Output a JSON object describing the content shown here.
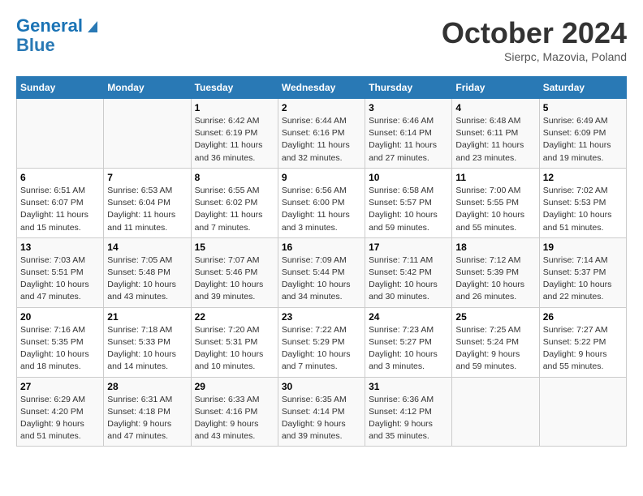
{
  "header": {
    "logo_line1": "General",
    "logo_line2": "Blue",
    "title": "October 2024",
    "subtitle": "Sierpc, Mazovia, Poland"
  },
  "weekdays": [
    "Sunday",
    "Monday",
    "Tuesday",
    "Wednesday",
    "Thursday",
    "Friday",
    "Saturday"
  ],
  "weeks": [
    [
      {
        "day": "",
        "sunrise": "",
        "sunset": "",
        "daylight": ""
      },
      {
        "day": "",
        "sunrise": "",
        "sunset": "",
        "daylight": ""
      },
      {
        "day": "1",
        "sunrise": "Sunrise: 6:42 AM",
        "sunset": "Sunset: 6:19 PM",
        "daylight": "Daylight: 11 hours and 36 minutes."
      },
      {
        "day": "2",
        "sunrise": "Sunrise: 6:44 AM",
        "sunset": "Sunset: 6:16 PM",
        "daylight": "Daylight: 11 hours and 32 minutes."
      },
      {
        "day": "3",
        "sunrise": "Sunrise: 6:46 AM",
        "sunset": "Sunset: 6:14 PM",
        "daylight": "Daylight: 11 hours and 27 minutes."
      },
      {
        "day": "4",
        "sunrise": "Sunrise: 6:48 AM",
        "sunset": "Sunset: 6:11 PM",
        "daylight": "Daylight: 11 hours and 23 minutes."
      },
      {
        "day": "5",
        "sunrise": "Sunrise: 6:49 AM",
        "sunset": "Sunset: 6:09 PM",
        "daylight": "Daylight: 11 hours and 19 minutes."
      }
    ],
    [
      {
        "day": "6",
        "sunrise": "Sunrise: 6:51 AM",
        "sunset": "Sunset: 6:07 PM",
        "daylight": "Daylight: 11 hours and 15 minutes."
      },
      {
        "day": "7",
        "sunrise": "Sunrise: 6:53 AM",
        "sunset": "Sunset: 6:04 PM",
        "daylight": "Daylight: 11 hours and 11 minutes."
      },
      {
        "day": "8",
        "sunrise": "Sunrise: 6:55 AM",
        "sunset": "Sunset: 6:02 PM",
        "daylight": "Daylight: 11 hours and 7 minutes."
      },
      {
        "day": "9",
        "sunrise": "Sunrise: 6:56 AM",
        "sunset": "Sunset: 6:00 PM",
        "daylight": "Daylight: 11 hours and 3 minutes."
      },
      {
        "day": "10",
        "sunrise": "Sunrise: 6:58 AM",
        "sunset": "Sunset: 5:57 PM",
        "daylight": "Daylight: 10 hours and 59 minutes."
      },
      {
        "day": "11",
        "sunrise": "Sunrise: 7:00 AM",
        "sunset": "Sunset: 5:55 PM",
        "daylight": "Daylight: 10 hours and 55 minutes."
      },
      {
        "day": "12",
        "sunrise": "Sunrise: 7:02 AM",
        "sunset": "Sunset: 5:53 PM",
        "daylight": "Daylight: 10 hours and 51 minutes."
      }
    ],
    [
      {
        "day": "13",
        "sunrise": "Sunrise: 7:03 AM",
        "sunset": "Sunset: 5:51 PM",
        "daylight": "Daylight: 10 hours and 47 minutes."
      },
      {
        "day": "14",
        "sunrise": "Sunrise: 7:05 AM",
        "sunset": "Sunset: 5:48 PM",
        "daylight": "Daylight: 10 hours and 43 minutes."
      },
      {
        "day": "15",
        "sunrise": "Sunrise: 7:07 AM",
        "sunset": "Sunset: 5:46 PM",
        "daylight": "Daylight: 10 hours and 39 minutes."
      },
      {
        "day": "16",
        "sunrise": "Sunrise: 7:09 AM",
        "sunset": "Sunset: 5:44 PM",
        "daylight": "Daylight: 10 hours and 34 minutes."
      },
      {
        "day": "17",
        "sunrise": "Sunrise: 7:11 AM",
        "sunset": "Sunset: 5:42 PM",
        "daylight": "Daylight: 10 hours and 30 minutes."
      },
      {
        "day": "18",
        "sunrise": "Sunrise: 7:12 AM",
        "sunset": "Sunset: 5:39 PM",
        "daylight": "Daylight: 10 hours and 26 minutes."
      },
      {
        "day": "19",
        "sunrise": "Sunrise: 7:14 AM",
        "sunset": "Sunset: 5:37 PM",
        "daylight": "Daylight: 10 hours and 22 minutes."
      }
    ],
    [
      {
        "day": "20",
        "sunrise": "Sunrise: 7:16 AM",
        "sunset": "Sunset: 5:35 PM",
        "daylight": "Daylight: 10 hours and 18 minutes."
      },
      {
        "day": "21",
        "sunrise": "Sunrise: 7:18 AM",
        "sunset": "Sunset: 5:33 PM",
        "daylight": "Daylight: 10 hours and 14 minutes."
      },
      {
        "day": "22",
        "sunrise": "Sunrise: 7:20 AM",
        "sunset": "Sunset: 5:31 PM",
        "daylight": "Daylight: 10 hours and 10 minutes."
      },
      {
        "day": "23",
        "sunrise": "Sunrise: 7:22 AM",
        "sunset": "Sunset: 5:29 PM",
        "daylight": "Daylight: 10 hours and 7 minutes."
      },
      {
        "day": "24",
        "sunrise": "Sunrise: 7:23 AM",
        "sunset": "Sunset: 5:27 PM",
        "daylight": "Daylight: 10 hours and 3 minutes."
      },
      {
        "day": "25",
        "sunrise": "Sunrise: 7:25 AM",
        "sunset": "Sunset: 5:24 PM",
        "daylight": "Daylight: 9 hours and 59 minutes."
      },
      {
        "day": "26",
        "sunrise": "Sunrise: 7:27 AM",
        "sunset": "Sunset: 5:22 PM",
        "daylight": "Daylight: 9 hours and 55 minutes."
      }
    ],
    [
      {
        "day": "27",
        "sunrise": "Sunrise: 6:29 AM",
        "sunset": "Sunset: 4:20 PM",
        "daylight": "Daylight: 9 hours and 51 minutes."
      },
      {
        "day": "28",
        "sunrise": "Sunrise: 6:31 AM",
        "sunset": "Sunset: 4:18 PM",
        "daylight": "Daylight: 9 hours and 47 minutes."
      },
      {
        "day": "29",
        "sunrise": "Sunrise: 6:33 AM",
        "sunset": "Sunset: 4:16 PM",
        "daylight": "Daylight: 9 hours and 43 minutes."
      },
      {
        "day": "30",
        "sunrise": "Sunrise: 6:35 AM",
        "sunset": "Sunset: 4:14 PM",
        "daylight": "Daylight: 9 hours and 39 minutes."
      },
      {
        "day": "31",
        "sunrise": "Sunrise: 6:36 AM",
        "sunset": "Sunset: 4:12 PM",
        "daylight": "Daylight: 9 hours and 35 minutes."
      },
      {
        "day": "",
        "sunrise": "",
        "sunset": "",
        "daylight": ""
      },
      {
        "day": "",
        "sunrise": "",
        "sunset": "",
        "daylight": ""
      }
    ]
  ]
}
